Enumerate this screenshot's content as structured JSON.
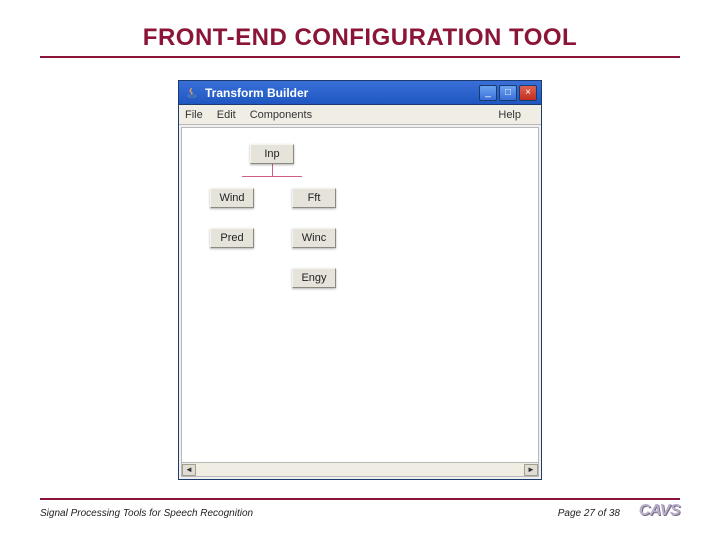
{
  "slide": {
    "title": "FRONT-END CONFIGURATION TOOL",
    "footer_left": "Signal Processing Tools for Speech Recognition",
    "footer_page": "Page 27 of 38",
    "footer_logo": "CAVS"
  },
  "window": {
    "title": "Transform Builder",
    "minimize_glyph": "_",
    "maximize_glyph": "□",
    "close_glyph": "×",
    "menu": {
      "file": "File",
      "edit": "Edit",
      "components": "Components",
      "help": "Help"
    },
    "scroll_left_glyph": "◄",
    "scroll_right_glyph": "►"
  },
  "blocks": {
    "inp": "Inp",
    "wind": "Wind",
    "fft": "Fft",
    "pred": "Pred",
    "winc": "Winc",
    "engy": "Engy"
  }
}
